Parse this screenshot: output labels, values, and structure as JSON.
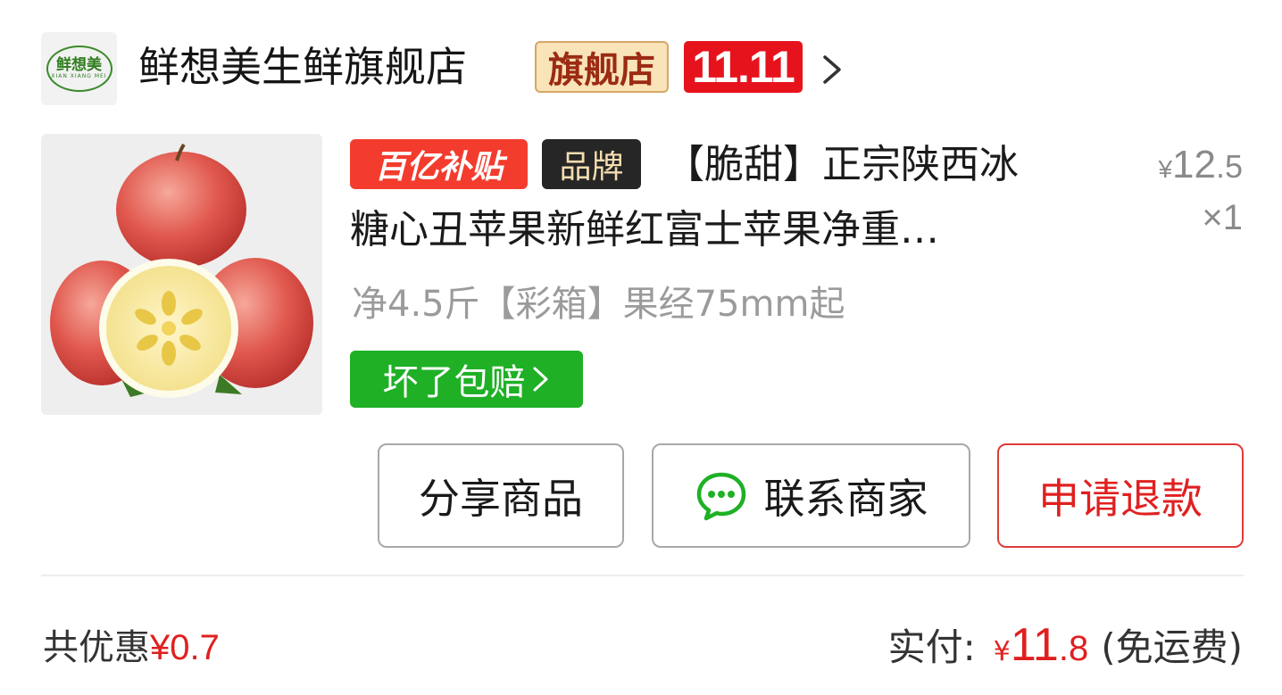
{
  "store": {
    "logo_text": "鲜想美",
    "logo_sub": "XIAN XIANG MEI",
    "name": "鲜想美生鲜旗舰店",
    "flagship_tag": "旗舰店",
    "promo_tag": "11.11"
  },
  "product": {
    "subsidy_tag": "百亿补贴",
    "brand_tag": "品牌",
    "title_line1": "【脆甜】正宗陕西冰",
    "title_line2": "糖心丑苹果新鲜红富士苹果净重…",
    "unit_price_symbol": "¥",
    "unit_price_int": "12",
    "unit_price_dec": ".5",
    "quantity": "×1",
    "spec": "净4.5斤【彩箱】果经75mm起",
    "guarantee": "坏了包赔"
  },
  "actions": {
    "share": "分享商品",
    "contact": "联系商家",
    "refund": "申请退款"
  },
  "summary": {
    "discount_label": "共优惠",
    "discount_value": "¥0.7",
    "paid_label": "实付:",
    "paid_symbol": "¥",
    "paid_int": "11",
    "paid_dec": ".8",
    "shipping": "(免运费)"
  },
  "colors": {
    "accent_red": "#e02020",
    "promo_red": "#e6131d",
    "guarantee_green": "#1fb026",
    "brand_dark": "#262626"
  }
}
